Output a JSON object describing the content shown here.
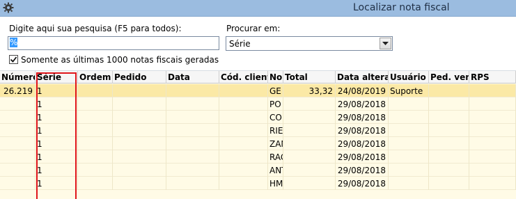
{
  "window": {
    "title": "Localizar nota fiscal",
    "icon": "gear-icon"
  },
  "search": {
    "label": "Digite aqui sua pesquisa (F5 para todos):",
    "value": "%",
    "search_in_label": "Procurar em:",
    "search_in_value": "Série",
    "only_last_label": "Somente as últimas 1000 notas fiscais geradas",
    "only_last_checked": true
  },
  "table": {
    "columns": [
      "Número",
      "Série",
      "Ordem",
      "Pedido",
      "Data",
      "Cód. cliente",
      "Nor",
      "Total",
      "Data alterad",
      "Usuário",
      "Ped. vend",
      "RPS"
    ],
    "rows": [
      {
        "numero": "26.219",
        "serie": "1",
        "nome": "GE",
        "total": "33,32",
        "data_alt": "24/08/2019",
        "usuario": "Suporte"
      },
      {
        "numero": "",
        "serie": "1",
        "nome": "PO",
        "total": "",
        "data_alt": "29/08/2018",
        "usuario": ""
      },
      {
        "numero": "",
        "serie": "1",
        "nome": "CO",
        "total": "",
        "data_alt": "29/08/2018",
        "usuario": ""
      },
      {
        "numero": "",
        "serie": "1",
        "nome": "RIE",
        "total": "",
        "data_alt": "29/08/2018",
        "usuario": ""
      },
      {
        "numero": "",
        "serie": "1",
        "nome": "ZAN",
        "total": "",
        "data_alt": "29/08/2018",
        "usuario": ""
      },
      {
        "numero": "",
        "serie": "1",
        "nome": "RAG",
        "total": "",
        "data_alt": "29/08/2018",
        "usuario": ""
      },
      {
        "numero": "",
        "serie": "1",
        "nome": "ANT",
        "total": "",
        "data_alt": "29/08/2018",
        "usuario": ""
      },
      {
        "numero": "",
        "serie": "1",
        "nome": "HM",
        "total": "",
        "data_alt": "29/08/2018",
        "usuario": ""
      }
    ]
  },
  "colors": {
    "titlebar": "#9bbce0",
    "selected_row": "#fbe9a6",
    "grid_bg": "#fffbe6",
    "highlight": "#e0161c"
  }
}
